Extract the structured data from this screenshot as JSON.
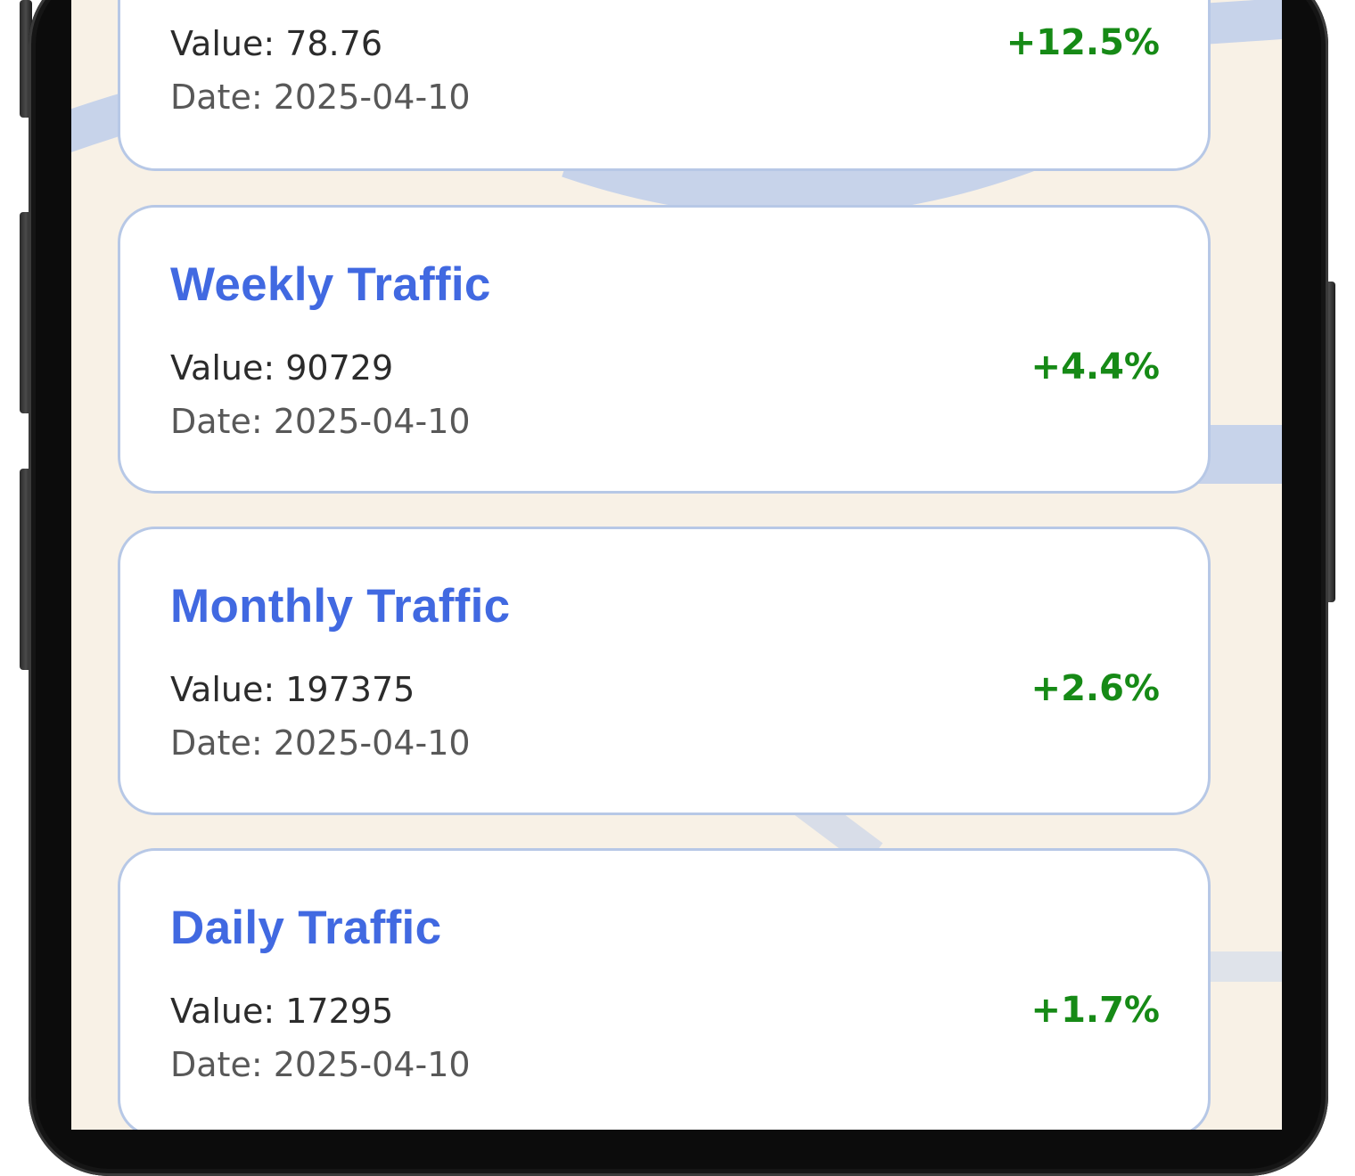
{
  "colors": {
    "title": "#4169e1",
    "change_positive": "#168a16",
    "card_border": "#b7c8e6",
    "screen_background": "#f8f1e6"
  },
  "cards": [
    {
      "title": "",
      "value": "Value: 78.76",
      "date": "Date: 2025-04-10",
      "change": "+12.5%"
    },
    {
      "title": "Weekly Traffic",
      "value": "Value: 90729",
      "date": "Date: 2025-04-10",
      "change": "+4.4%"
    },
    {
      "title": "Monthly Traffic",
      "value": "Value: 197375",
      "date": "Date: 2025-04-10",
      "change": "+2.6%"
    },
    {
      "title": "Daily Traffic",
      "value": "Value: 17295",
      "date": "Date: 2025-04-10",
      "change": "+1.7%"
    }
  ]
}
